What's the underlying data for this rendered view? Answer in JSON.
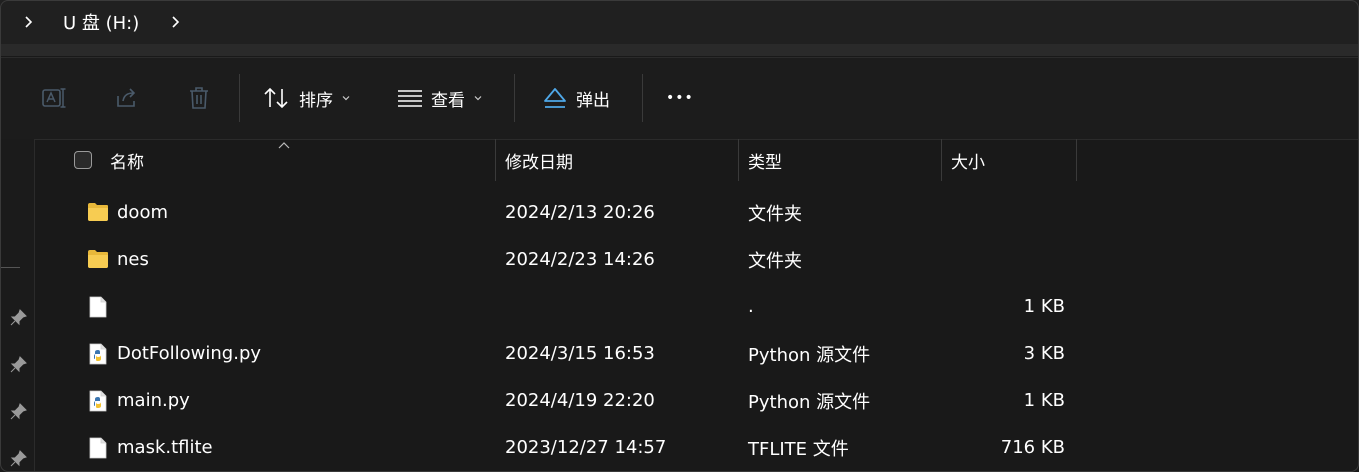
{
  "address": {
    "path": "U 盘 (H:)"
  },
  "toolbar": {
    "sort_label": "排序",
    "view_label": "查看",
    "eject_label": "弹出",
    "more_label": "•••"
  },
  "columns": {
    "name": "名称",
    "date": "修改日期",
    "type": "类型",
    "size": "大小"
  },
  "files": [
    {
      "icon": "folder-icon",
      "name": "doom",
      "date": "2024/2/13 20:26",
      "type": "文件夹",
      "size": ""
    },
    {
      "icon": "folder-icon",
      "name": "nes",
      "date": "2024/2/23 14:26",
      "type": "文件夹",
      "size": ""
    },
    {
      "icon": "file-icon",
      "name": "",
      "date": "",
      "type": ".",
      "size": "1 KB"
    },
    {
      "icon": "python-file-icon",
      "name": "DotFollowing.py",
      "date": "2024/3/15 16:53",
      "type": "Python 源文件",
      "size": "3 KB"
    },
    {
      "icon": "python-file-icon",
      "name": "main.py",
      "date": "2024/4/19 22:20",
      "type": "Python 源文件",
      "size": "1 KB"
    },
    {
      "icon": "file-icon",
      "name": "mask.tflite",
      "date": "2023/12/27 14:57",
      "type": "TFLITE 文件",
      "size": "716 KB"
    }
  ]
}
